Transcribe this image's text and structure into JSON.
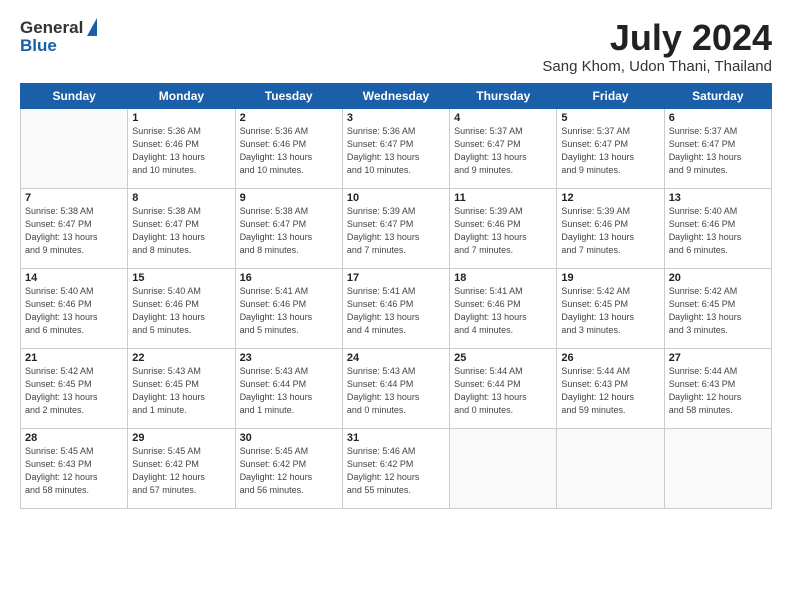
{
  "header": {
    "logo_general": "General",
    "logo_blue": "Blue",
    "month_title": "July 2024",
    "location": "Sang Khom, Udon Thani, Thailand"
  },
  "days_of_week": [
    "Sunday",
    "Monday",
    "Tuesday",
    "Wednesday",
    "Thursday",
    "Friday",
    "Saturday"
  ],
  "weeks": [
    [
      {
        "day": "",
        "info": ""
      },
      {
        "day": "1",
        "info": "Sunrise: 5:36 AM\nSunset: 6:46 PM\nDaylight: 13 hours\nand 10 minutes."
      },
      {
        "day": "2",
        "info": "Sunrise: 5:36 AM\nSunset: 6:46 PM\nDaylight: 13 hours\nand 10 minutes."
      },
      {
        "day": "3",
        "info": "Sunrise: 5:36 AM\nSunset: 6:47 PM\nDaylight: 13 hours\nand 10 minutes."
      },
      {
        "day": "4",
        "info": "Sunrise: 5:37 AM\nSunset: 6:47 PM\nDaylight: 13 hours\nand 9 minutes."
      },
      {
        "day": "5",
        "info": "Sunrise: 5:37 AM\nSunset: 6:47 PM\nDaylight: 13 hours\nand 9 minutes."
      },
      {
        "day": "6",
        "info": "Sunrise: 5:37 AM\nSunset: 6:47 PM\nDaylight: 13 hours\nand 9 minutes."
      }
    ],
    [
      {
        "day": "7",
        "info": "Sunrise: 5:38 AM\nSunset: 6:47 PM\nDaylight: 13 hours\nand 9 minutes."
      },
      {
        "day": "8",
        "info": "Sunrise: 5:38 AM\nSunset: 6:47 PM\nDaylight: 13 hours\nand 8 minutes."
      },
      {
        "day": "9",
        "info": "Sunrise: 5:38 AM\nSunset: 6:47 PM\nDaylight: 13 hours\nand 8 minutes."
      },
      {
        "day": "10",
        "info": "Sunrise: 5:39 AM\nSunset: 6:47 PM\nDaylight: 13 hours\nand 7 minutes."
      },
      {
        "day": "11",
        "info": "Sunrise: 5:39 AM\nSunset: 6:46 PM\nDaylight: 13 hours\nand 7 minutes."
      },
      {
        "day": "12",
        "info": "Sunrise: 5:39 AM\nSunset: 6:46 PM\nDaylight: 13 hours\nand 7 minutes."
      },
      {
        "day": "13",
        "info": "Sunrise: 5:40 AM\nSunset: 6:46 PM\nDaylight: 13 hours\nand 6 minutes."
      }
    ],
    [
      {
        "day": "14",
        "info": "Sunrise: 5:40 AM\nSunset: 6:46 PM\nDaylight: 13 hours\nand 6 minutes."
      },
      {
        "day": "15",
        "info": "Sunrise: 5:40 AM\nSunset: 6:46 PM\nDaylight: 13 hours\nand 5 minutes."
      },
      {
        "day": "16",
        "info": "Sunrise: 5:41 AM\nSunset: 6:46 PM\nDaylight: 13 hours\nand 5 minutes."
      },
      {
        "day": "17",
        "info": "Sunrise: 5:41 AM\nSunset: 6:46 PM\nDaylight: 13 hours\nand 4 minutes."
      },
      {
        "day": "18",
        "info": "Sunrise: 5:41 AM\nSunset: 6:46 PM\nDaylight: 13 hours\nand 4 minutes."
      },
      {
        "day": "19",
        "info": "Sunrise: 5:42 AM\nSunset: 6:45 PM\nDaylight: 13 hours\nand 3 minutes."
      },
      {
        "day": "20",
        "info": "Sunrise: 5:42 AM\nSunset: 6:45 PM\nDaylight: 13 hours\nand 3 minutes."
      }
    ],
    [
      {
        "day": "21",
        "info": "Sunrise: 5:42 AM\nSunset: 6:45 PM\nDaylight: 13 hours\nand 2 minutes."
      },
      {
        "day": "22",
        "info": "Sunrise: 5:43 AM\nSunset: 6:45 PM\nDaylight: 13 hours\nand 1 minute."
      },
      {
        "day": "23",
        "info": "Sunrise: 5:43 AM\nSunset: 6:44 PM\nDaylight: 13 hours\nand 1 minute."
      },
      {
        "day": "24",
        "info": "Sunrise: 5:43 AM\nSunset: 6:44 PM\nDaylight: 13 hours\nand 0 minutes."
      },
      {
        "day": "25",
        "info": "Sunrise: 5:44 AM\nSunset: 6:44 PM\nDaylight: 13 hours\nand 0 minutes."
      },
      {
        "day": "26",
        "info": "Sunrise: 5:44 AM\nSunset: 6:43 PM\nDaylight: 12 hours\nand 59 minutes."
      },
      {
        "day": "27",
        "info": "Sunrise: 5:44 AM\nSunset: 6:43 PM\nDaylight: 12 hours\nand 58 minutes."
      }
    ],
    [
      {
        "day": "28",
        "info": "Sunrise: 5:45 AM\nSunset: 6:43 PM\nDaylight: 12 hours\nand 58 minutes."
      },
      {
        "day": "29",
        "info": "Sunrise: 5:45 AM\nSunset: 6:42 PM\nDaylight: 12 hours\nand 57 minutes."
      },
      {
        "day": "30",
        "info": "Sunrise: 5:45 AM\nSunset: 6:42 PM\nDaylight: 12 hours\nand 56 minutes."
      },
      {
        "day": "31",
        "info": "Sunrise: 5:46 AM\nSunset: 6:42 PM\nDaylight: 12 hours\nand 55 minutes."
      },
      {
        "day": "",
        "info": ""
      },
      {
        "day": "",
        "info": ""
      },
      {
        "day": "",
        "info": ""
      }
    ]
  ]
}
